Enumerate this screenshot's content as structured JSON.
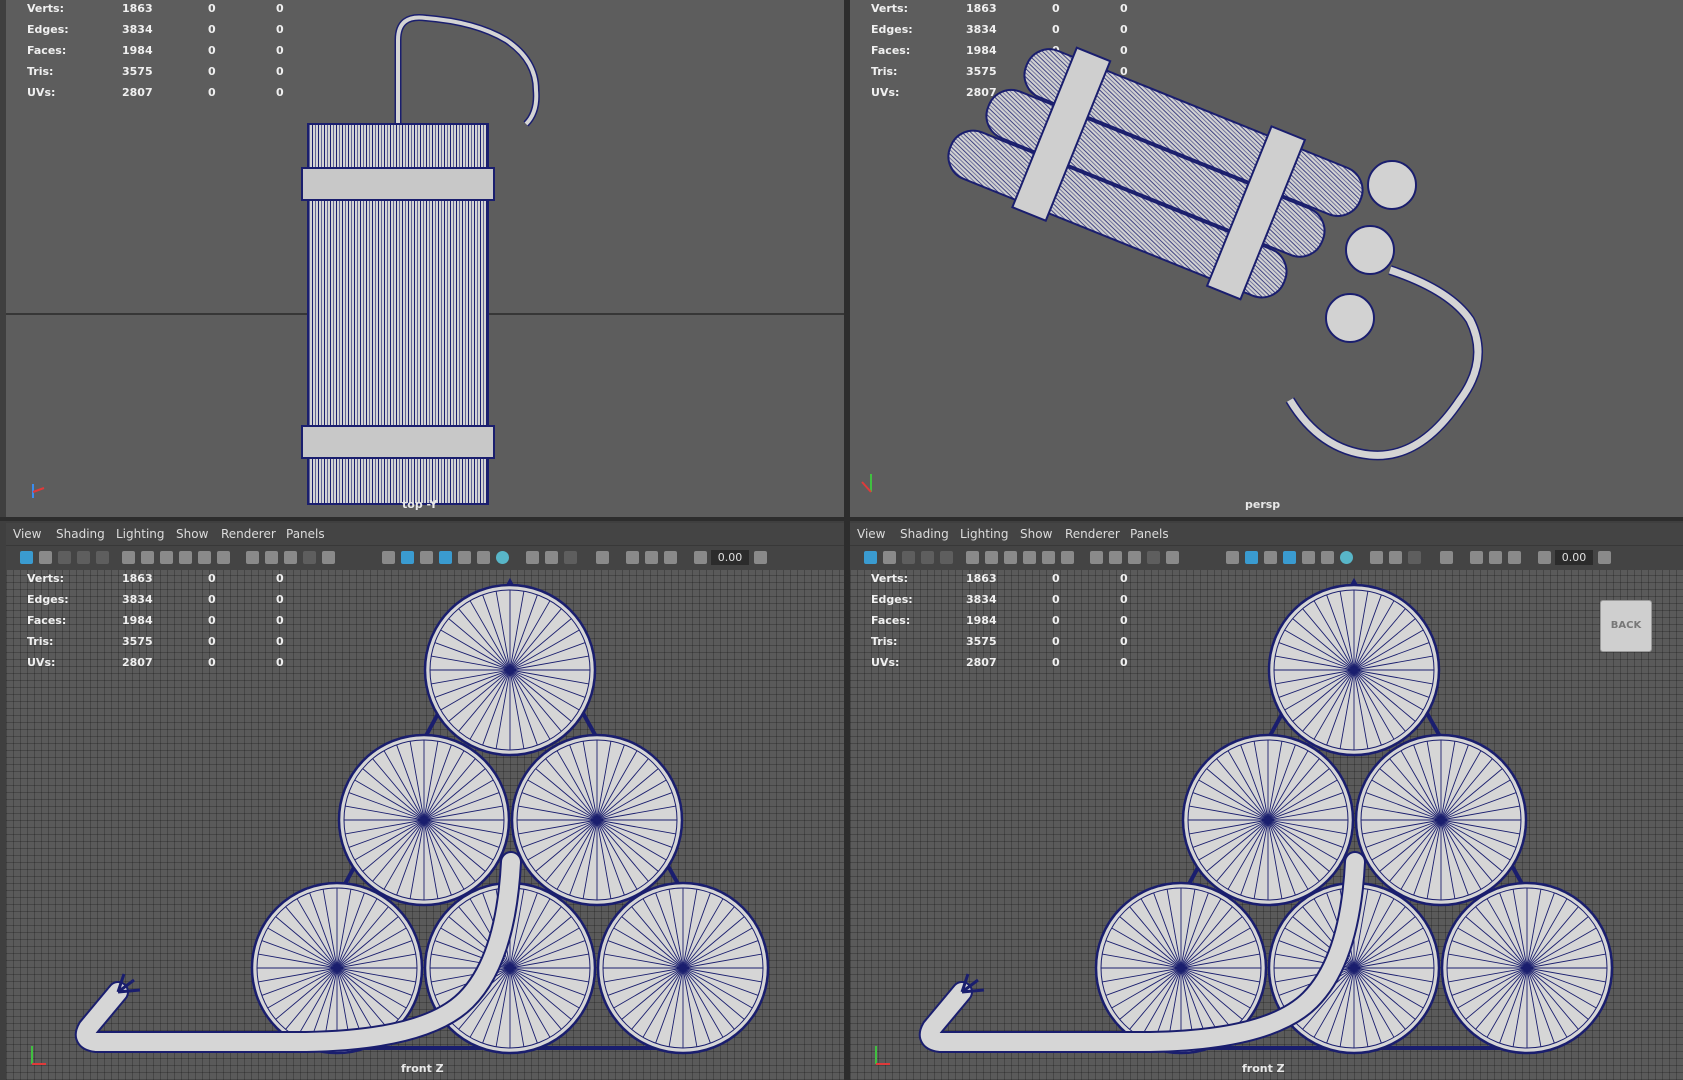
{
  "hud_stats": [
    {
      "label": "Verts:",
      "value": "1863",
      "sel": "0",
      "comp": "0"
    },
    {
      "label": "Edges:",
      "value": "3834",
      "sel": "0",
      "comp": "0"
    },
    {
      "label": "Faces:",
      "value": "1984",
      "sel": "0",
      "comp": "0"
    },
    {
      "label": "Tris:",
      "value": "3575",
      "sel": "0",
      "comp": "0"
    },
    {
      "label": "UVs:",
      "value": "2807",
      "sel": "0",
      "comp": "0"
    }
  ],
  "viewports": {
    "top": {
      "camera": "top -Y"
    },
    "persp": {
      "camera": "persp"
    },
    "front_left": {
      "camera": "front Z"
    },
    "front_right": {
      "camera": "front Z",
      "view_cube_label": "BACK"
    }
  },
  "panel_menu": [
    "View",
    "Shading",
    "Lighting",
    "Show",
    "Renderer",
    "Panels"
  ],
  "toolbar": {
    "exposure_value": "0.00"
  },
  "colors": {
    "wire": "#1a1e6e",
    "surface": "#d6d6d6",
    "viewport_bg": "#5d5d5d",
    "accent": "#3a9bd0"
  }
}
